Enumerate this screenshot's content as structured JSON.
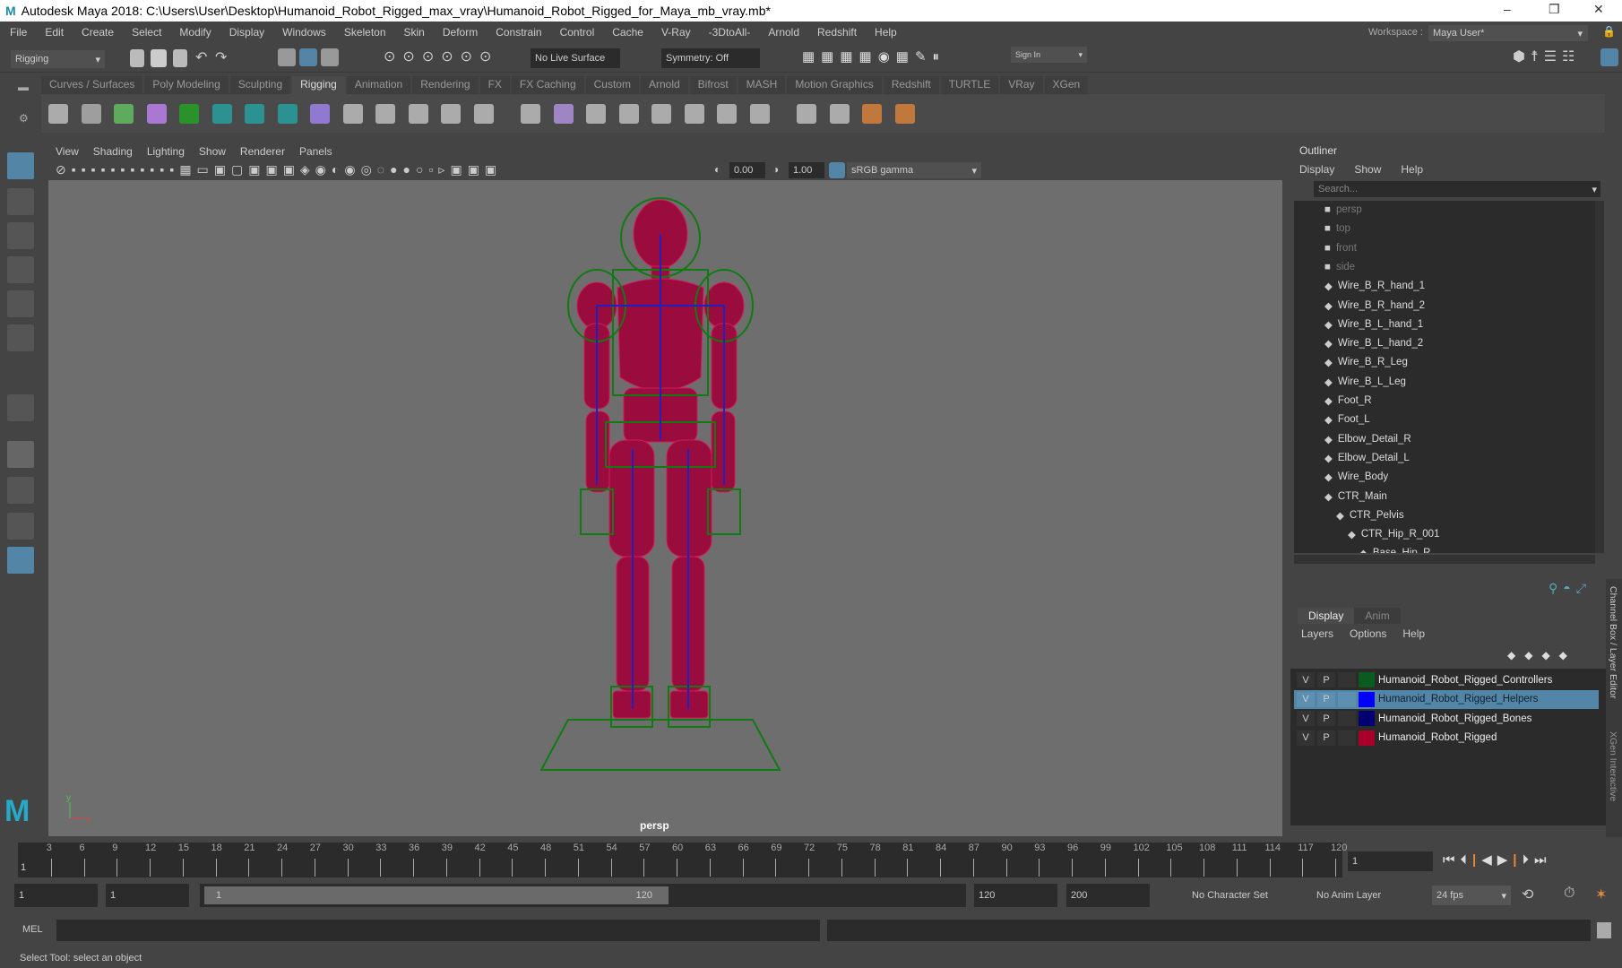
{
  "title": "Autodesk Maya 2018: C:\\Users\\User\\Desktop\\Humanoid_Robot_Rigged_max_vray\\Humanoid_Robot_Rigged_for_Maya_mb_vray.mb*",
  "menu": [
    "File",
    "Edit",
    "Create",
    "Select",
    "Modify",
    "Display",
    "Windows",
    "Skeleton",
    "Skin",
    "Deform",
    "Constrain",
    "Control",
    "Cache",
    "V-Ray",
    "-3DtoAll-",
    "Arnold",
    "Redshift",
    "Help"
  ],
  "workspace_label": "Workspace :",
  "workspace_value": "Maya User*",
  "status": {
    "mode": "Rigging",
    "live_surface": "No Live Surface",
    "symmetry": "Symmetry: Off",
    "sign_in": "Sign In"
  },
  "shelf_tabs": [
    "Curves / Surfaces",
    "Poly Modeling",
    "Sculpting",
    "Rigging",
    "Animation",
    "Rendering",
    "FX",
    "FX Caching",
    "Custom",
    "Arnold",
    "Bifrost",
    "MASH",
    "Motion Graphics",
    "Redshift",
    "TURTLE",
    "VRay",
    "XGen"
  ],
  "shelf_active": "Rigging",
  "viewport": {
    "menu": [
      "View",
      "Shading",
      "Lighting",
      "Show",
      "Renderer",
      "Panels"
    ],
    "exposure": "0.00",
    "gamma": "1.00",
    "colorspace": "sRGB gamma",
    "camera": "persp"
  },
  "outliner": {
    "title": "Outliner",
    "menu": [
      "Display",
      "Show",
      "Help"
    ],
    "search_placeholder": "Search...",
    "items": [
      {
        "name": "persp",
        "dim": true,
        "indent": 0
      },
      {
        "name": "top",
        "dim": true,
        "indent": 0
      },
      {
        "name": "front",
        "dim": true,
        "indent": 0
      },
      {
        "name": "side",
        "dim": true,
        "indent": 0
      },
      {
        "name": "Wire_B_R_hand_1",
        "indent": 0
      },
      {
        "name": "Wire_B_R_hand_2",
        "indent": 0
      },
      {
        "name": "Wire_B_L_hand_1",
        "indent": 0
      },
      {
        "name": "Wire_B_L_hand_2",
        "indent": 0
      },
      {
        "name": "Wire_B_R_Leg",
        "indent": 0
      },
      {
        "name": "Wire_B_L_Leg",
        "indent": 0
      },
      {
        "name": "Foot_R",
        "indent": 0
      },
      {
        "name": "Foot_L",
        "indent": 0
      },
      {
        "name": "Elbow_Detail_R",
        "indent": 0
      },
      {
        "name": "Elbow_Detail_L",
        "indent": 0
      },
      {
        "name": "Wire_Body",
        "indent": 0
      },
      {
        "name": "CTR_Main",
        "indent": 0
      },
      {
        "name": "CTR_Pelvis",
        "indent": 1
      },
      {
        "name": "CTR_Hip_R_001",
        "indent": 2
      },
      {
        "name": "Base_Hip_R",
        "indent": 3
      }
    ]
  },
  "layers": {
    "tabs": [
      "Display",
      "Anim"
    ],
    "menu": [
      "Layers",
      "Options",
      "Help"
    ],
    "rows": [
      {
        "v": "V",
        "p": "P",
        "name": "Humanoid_Robot_Rigged_Controllers",
        "color": "#0b5a1e",
        "selected": false
      },
      {
        "v": "V",
        "p": "P",
        "name": "Humanoid_Robot_Rigged_Helpers",
        "color": "#0000ff",
        "selected": true
      },
      {
        "v": "V",
        "p": "P",
        "name": "Humanoid_Robot_Rigged_Bones",
        "color": "#000070",
        "selected": false
      },
      {
        "v": "V",
        "p": "P",
        "name": "Humanoid_Robot_Rigged",
        "color": "#a8002a",
        "selected": false
      }
    ]
  },
  "side_tabs": [
    "Channel Box / Layer Editor",
    "XGen Interactive"
  ],
  "timeline": {
    "ticks": [
      3,
      6,
      9,
      12,
      15,
      18,
      21,
      24,
      27,
      30,
      33,
      36,
      39,
      42,
      45,
      48,
      51,
      54,
      57,
      60,
      63,
      66,
      69,
      72,
      75,
      78,
      81,
      84,
      87,
      90,
      93,
      96,
      99,
      102,
      105,
      108,
      111,
      114,
      117,
      120
    ],
    "start_label": "1",
    "current_frame": "1"
  },
  "range": {
    "start": "1",
    "anim_start": "1",
    "slider_start": "1",
    "slider_end": "120",
    "end": "120",
    "anim_end": "200",
    "character_set": "No Character Set",
    "anim_layer": "No Anim Layer",
    "fps": "24 fps"
  },
  "mel": {
    "label": "MEL"
  },
  "help_line": "Select Tool: select an object"
}
